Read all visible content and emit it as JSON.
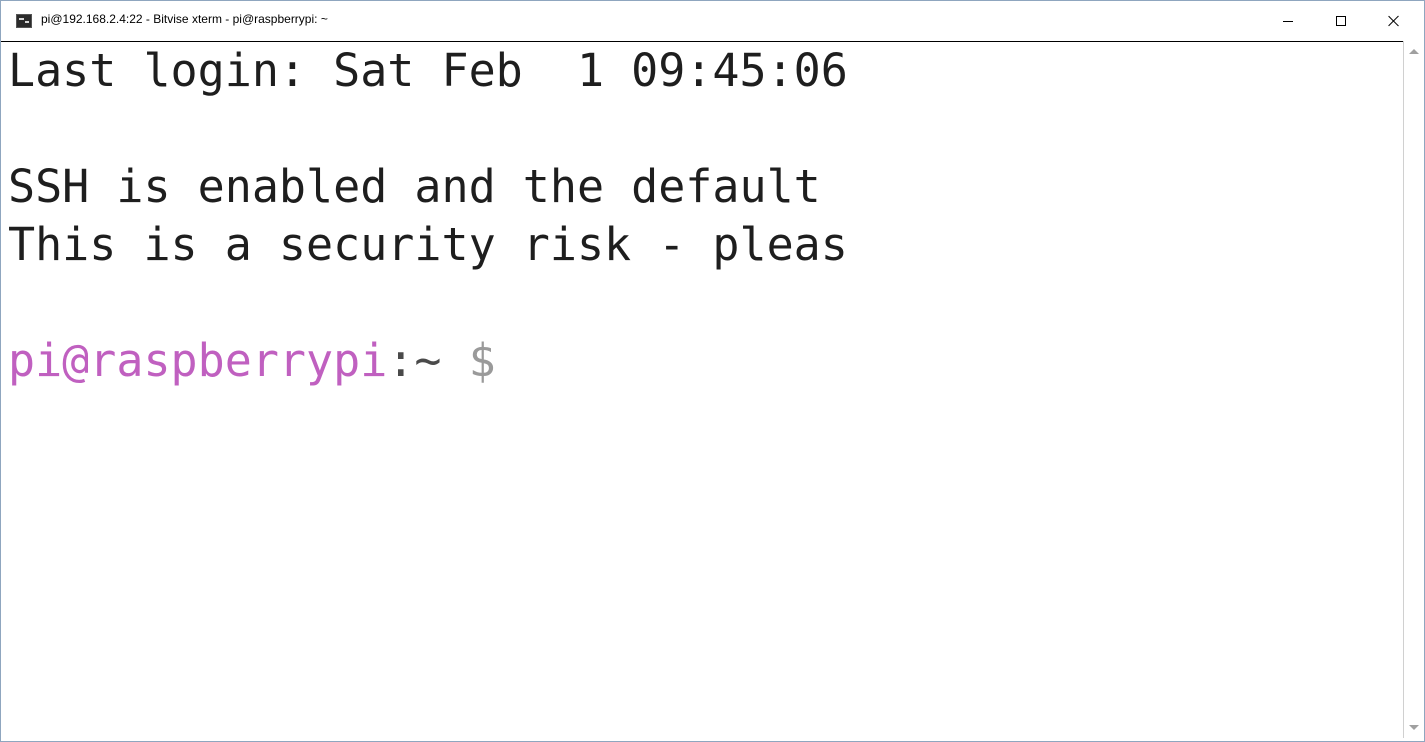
{
  "window": {
    "title": "pi@192.168.2.4:22 - Bitvise xterm - pi@raspberrypi: ~",
    "controls": {
      "minimize": "—",
      "maximize": "☐",
      "close": "✕"
    }
  },
  "terminal": {
    "lines": [
      "Last login: Sat Feb  1 09:45:06",
      "",
      "SSH is enabled and the default",
      "This is a security risk - pleas",
      ""
    ],
    "prompt": {
      "user_host": "pi@raspberrypi",
      "path": ":~",
      "symbol": " $"
    }
  },
  "colors": {
    "prompt_user": "#c060c0",
    "text": "#1e1e1e",
    "background": "#ffffff"
  }
}
